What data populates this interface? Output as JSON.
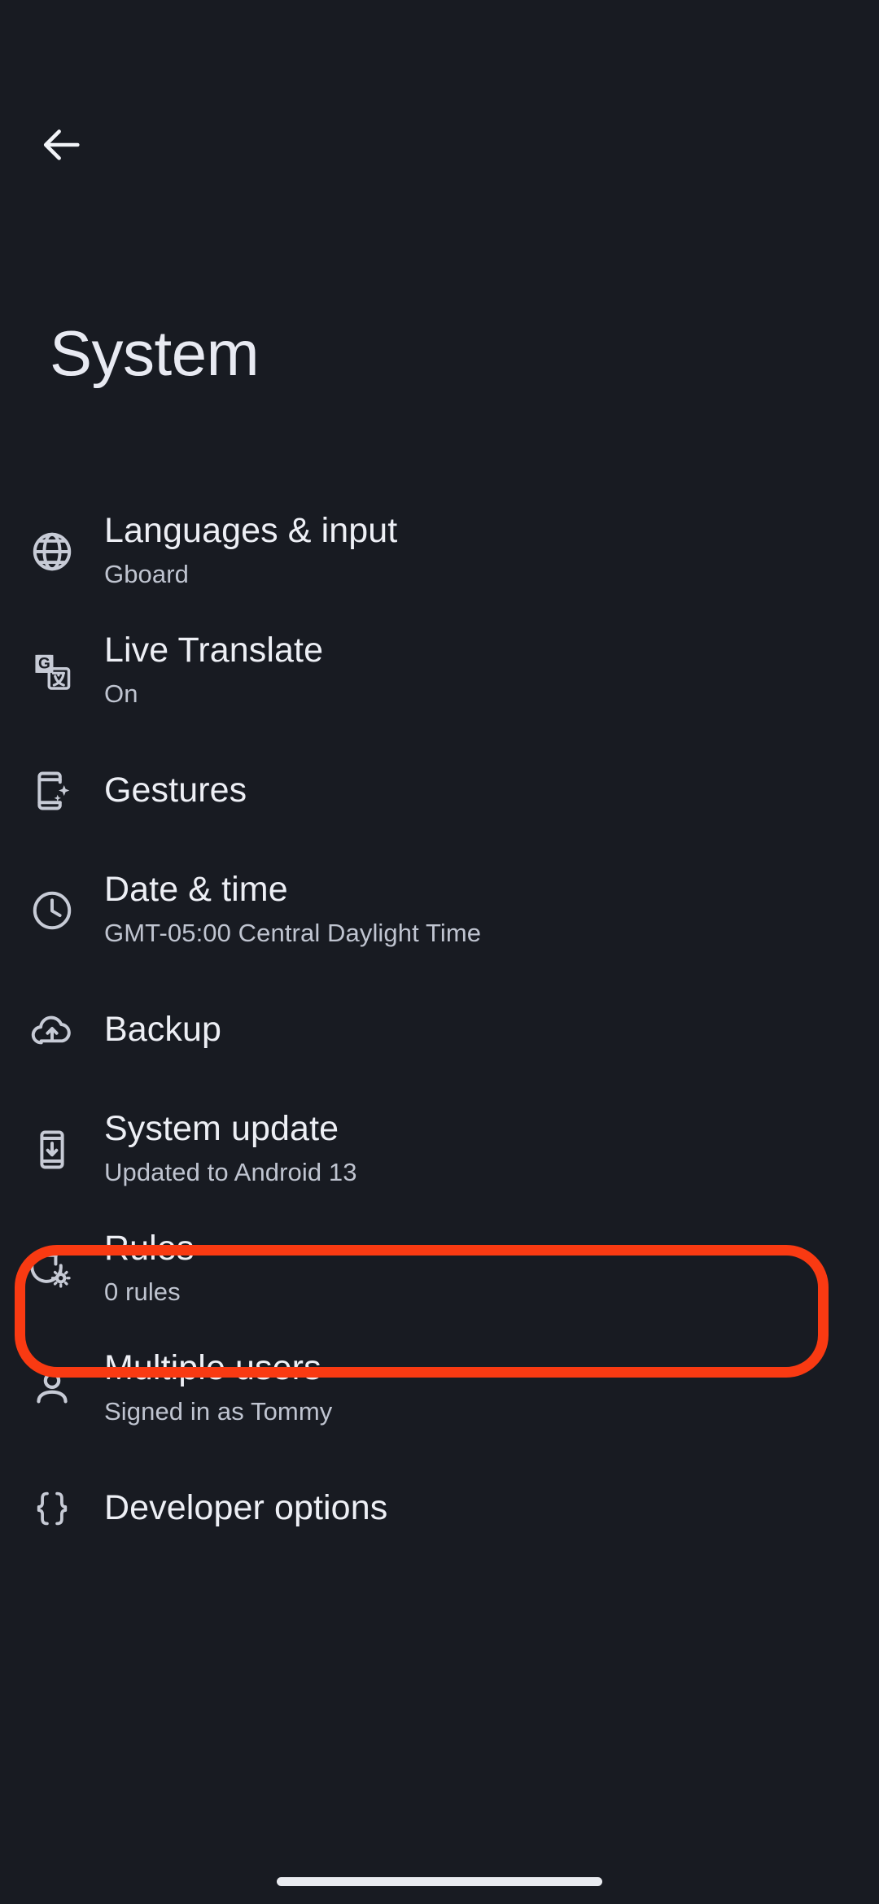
{
  "app": {
    "screen_title": "System",
    "background_color": "#181B22",
    "highlight_color": "#F93A12"
  },
  "topbar": {
    "back_icon": "arrow-left-icon"
  },
  "list": {
    "items": [
      {
        "icon": "globe-icon",
        "title": "Languages & input",
        "subtitle": "Gboard",
        "highlighted": false
      },
      {
        "icon": "google-translate-icon",
        "title": "Live Translate",
        "subtitle": "On",
        "highlighted": false
      },
      {
        "icon": "phone-sparkle-gesture-icon",
        "title": "Gestures",
        "subtitle": "",
        "highlighted": false
      },
      {
        "icon": "clock-icon",
        "title": "Date & time",
        "subtitle": "GMT-05:00 Central Daylight Time",
        "highlighted": false
      },
      {
        "icon": "cloud-upload-backup-icon",
        "title": "Backup",
        "subtitle": "",
        "highlighted": false
      },
      {
        "icon": "phone-download-update-icon",
        "title": "System update",
        "subtitle": "Updated to Android 13",
        "highlighted": true
      },
      {
        "icon": "rotate-gear-rules-icon",
        "title": "Rules",
        "subtitle": "0 rules",
        "highlighted": false
      },
      {
        "icon": "person-icon",
        "title": "Multiple users",
        "subtitle": "Signed in as Tommy",
        "highlighted": false
      },
      {
        "icon": "curly-braces-icon",
        "title": "Developer options",
        "subtitle": "",
        "highlighted": false
      }
    ]
  },
  "navigation": {
    "gesture_bar": "home-gesture-bar"
  }
}
